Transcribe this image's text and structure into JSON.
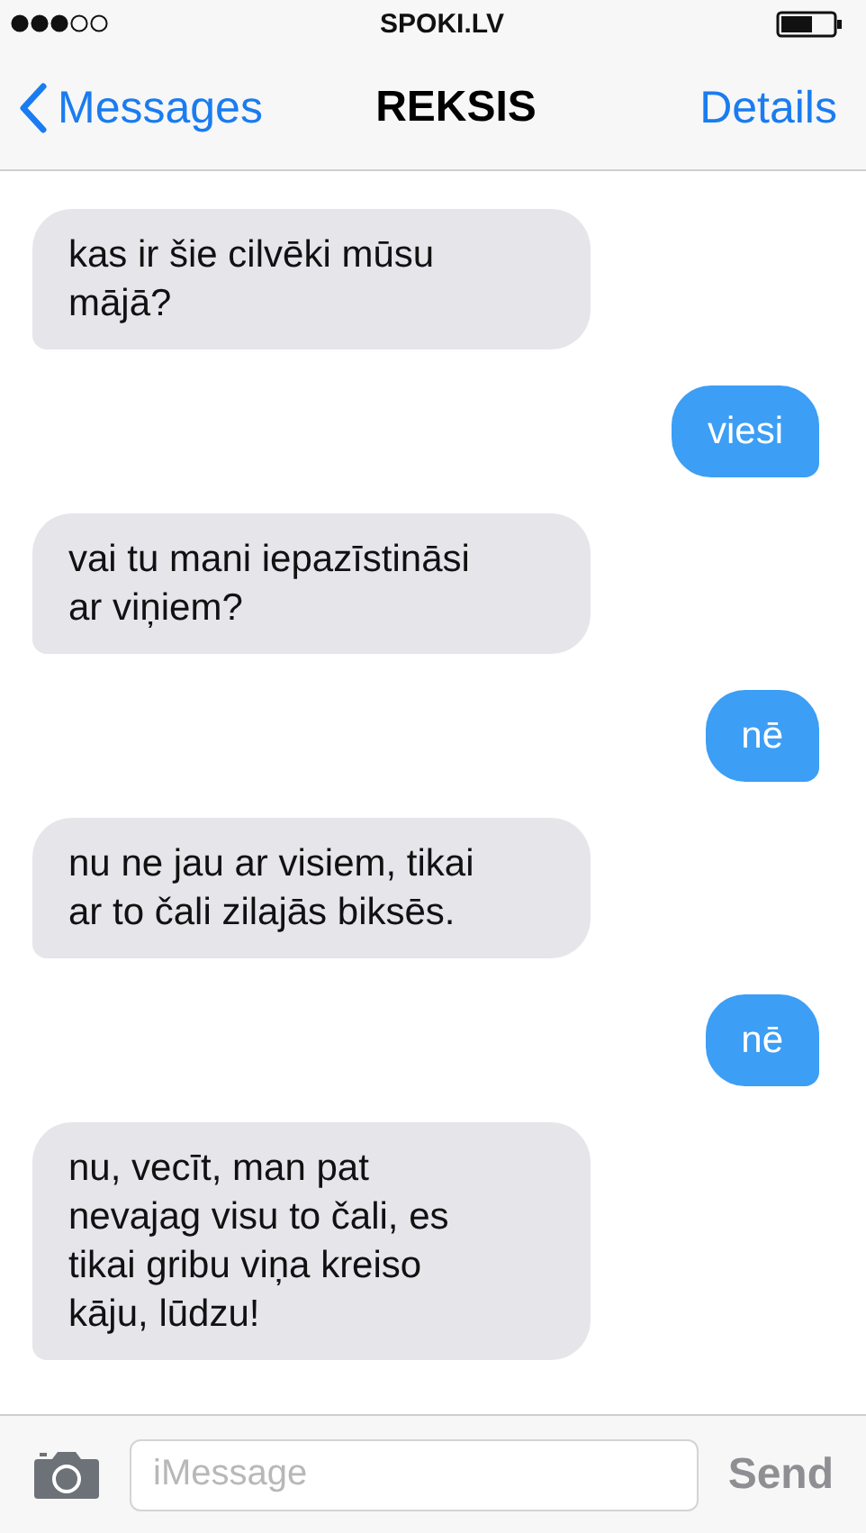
{
  "status_bar": {
    "carrier": "SPOKI.LV"
  },
  "nav_bar": {
    "back": "Messages",
    "title": "REKSIS",
    "action": "Details"
  },
  "messages": [
    {
      "kind": "received",
      "lines": [
        "kas ir šie cilvēki mūsu",
        "mājā?"
      ]
    },
    {
      "kind": "sent",
      "lines": [
        "viesi"
      ]
    },
    {
      "kind": "received",
      "lines": [
        "vai tu mani iepazīstināsi",
        "ar viņiem?"
      ]
    },
    {
      "kind": "sent",
      "lines": [
        "nē"
      ]
    },
    {
      "kind": "received",
      "lines": [
        "nu ne jau ar visiem, tikai",
        "ar to čali zilajās biksēs."
      ]
    },
    {
      "kind": "sent",
      "lines": [
        "nē"
      ]
    },
    {
      "kind": "received",
      "lines": [
        "nu, vecīt, man pat",
        "nevajag visu to čali, es",
        "tikai gribu viņa kreiso",
        "kāju, lūdzu!"
      ]
    }
  ],
  "composer": {
    "placeholder": "iMessage",
    "send": "Send"
  }
}
